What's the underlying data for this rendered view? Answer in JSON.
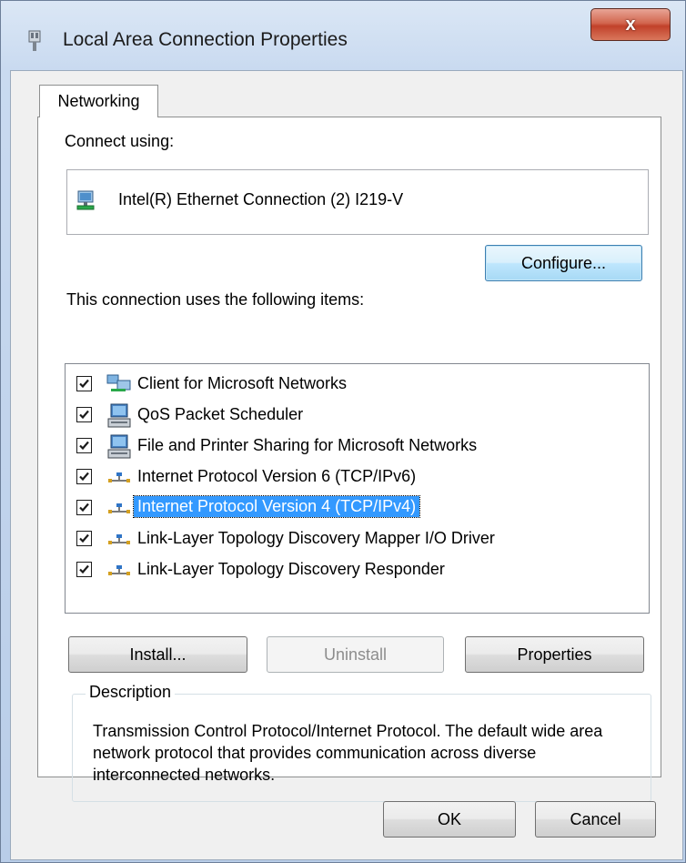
{
  "window": {
    "title": "Local Area Connection Properties",
    "close_label": "x"
  },
  "tabs": [
    {
      "label": "Networking",
      "active": true
    }
  ],
  "networking": {
    "connect_using_label": "Connect using:",
    "adapter_name": "Intel(R) Ethernet Connection (2) I219-V",
    "configure_button": "Configure...",
    "items_label": "This connection uses the following items:",
    "items": [
      {
        "label": "Client for Microsoft Networks",
        "checked": true,
        "icon": "network-client-icon"
      },
      {
        "label": "QoS Packet Scheduler",
        "checked": true,
        "icon": "service-computer-icon"
      },
      {
        "label": "File and Printer Sharing for Microsoft Networks",
        "checked": true,
        "icon": "service-computer-icon"
      },
      {
        "label": "Internet Protocol Version 6 (TCP/IPv6)",
        "checked": true,
        "icon": "protocol-icon"
      },
      {
        "label": "Internet Protocol Version 4 (TCP/IPv4)",
        "checked": true,
        "icon": "protocol-icon",
        "selected": true
      },
      {
        "label": "Link-Layer Topology Discovery Mapper I/O Driver",
        "checked": true,
        "icon": "protocol-icon"
      },
      {
        "label": "Link-Layer Topology Discovery Responder",
        "checked": true,
        "icon": "protocol-icon"
      }
    ],
    "install_button": "Install...",
    "uninstall_button": "Uninstall",
    "properties_button": "Properties",
    "description_legend": "Description",
    "description_text": "Transmission Control Protocol/Internet Protocol. The default wide area network protocol that provides communication across diverse interconnected networks."
  },
  "footer": {
    "ok_button": "OK",
    "cancel_button": "Cancel"
  },
  "colors": {
    "selection": "#3399ff",
    "close_button": "#c1412a",
    "default_button_border": "#3c7fb1"
  }
}
